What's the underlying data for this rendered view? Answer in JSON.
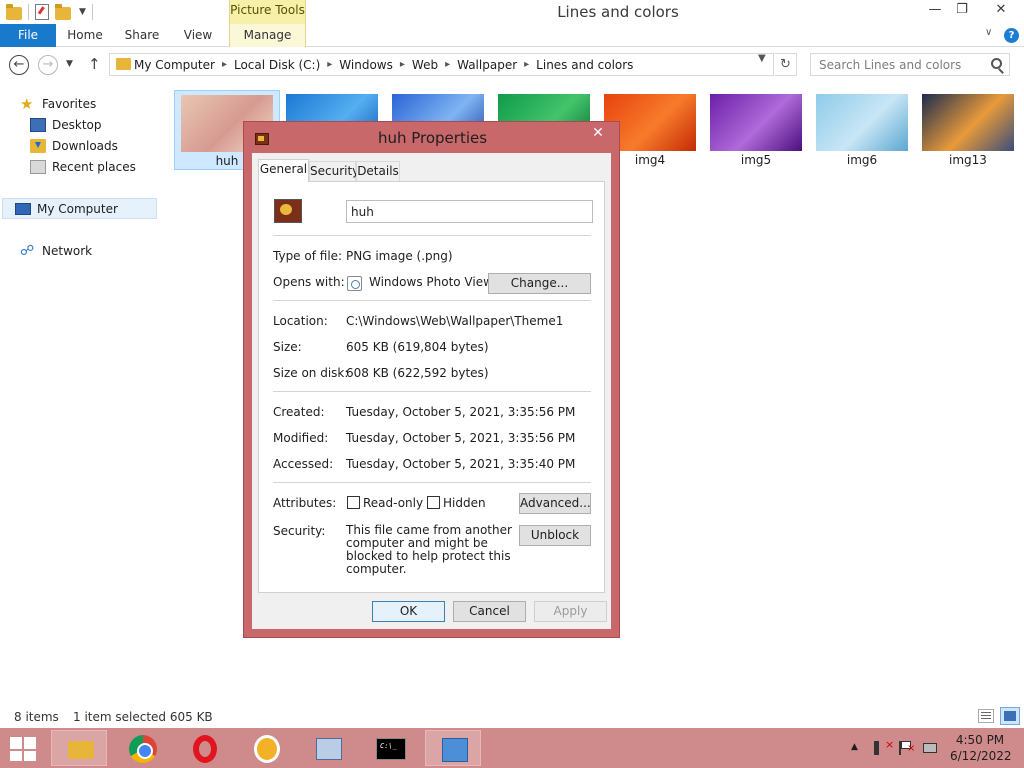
{
  "window": {
    "title": "Lines and colors",
    "context_tab": "Picture Tools",
    "controls": {
      "minimize": "—",
      "maximize": "❐",
      "close": "✕"
    }
  },
  "ribbon": {
    "file": "File",
    "tabs": [
      "Home",
      "Share",
      "View",
      "Manage"
    ]
  },
  "address": {
    "breadcrumbs": [
      "My Computer",
      "Local Disk (C:)",
      "Windows",
      "Web",
      "Wallpaper",
      "Lines and colors"
    ],
    "search_placeholder": "Search Lines and colors"
  },
  "navpane": {
    "favorites": "Favorites",
    "desktop": "Desktop",
    "downloads": "Downloads",
    "recent": "Recent places",
    "my_computer": "My Computer",
    "network": "Network"
  },
  "thumbnails": [
    {
      "label": "huh",
      "selected": true,
      "colors": [
        "#e8c7b1",
        "#d79a91",
        "#f1ddc9"
      ]
    },
    {
      "label": "",
      "selected": false,
      "colors": [
        "#1b78d4",
        "#55aef0",
        "#0f59b5"
      ]
    },
    {
      "label": "",
      "selected": false,
      "colors": [
        "#2a64d6",
        "#7fb4f3",
        "#1a3fa0"
      ]
    },
    {
      "label": "",
      "selected": false,
      "colors": [
        "#0f9a4a",
        "#43c46b",
        "#076a31"
      ]
    },
    {
      "label": "img4",
      "selected": false,
      "colors": [
        "#e8420f",
        "#f77b2a",
        "#c42a06"
      ]
    },
    {
      "label": "img5",
      "selected": false,
      "colors": [
        "#6b1fa8",
        "#b06ad9",
        "#4b0f7e"
      ]
    },
    {
      "label": "img6",
      "selected": false,
      "colors": [
        "#8fcbea",
        "#c8e6f5",
        "#5ca6d1"
      ]
    },
    {
      "label": "img13",
      "selected": false,
      "colors": [
        "#1c2c4e",
        "#e89a3a",
        "#3a4d7a"
      ]
    }
  ],
  "status": {
    "items": "8 items",
    "selected": "1 item selected  605 KB"
  },
  "dialog": {
    "title": "huh Properties",
    "close": "✕",
    "tabs": [
      "General",
      "Security",
      "Details"
    ],
    "filename": "huh",
    "type_label": "Type of file:",
    "type_value": "PNG image (.png)",
    "opens_label": "Opens with:",
    "opens_value": "Windows Photo Viewer",
    "change_button": "Change...",
    "location_label": "Location:",
    "location_value": "C:\\Windows\\Web\\Wallpaper\\Theme1",
    "size_label": "Size:",
    "size_value": "605 KB (619,804 bytes)",
    "disk_label": "Size on disk:",
    "disk_value": "608 KB (622,592 bytes)",
    "created_label": "Created:",
    "created_value": "Tuesday, October 5, 2021, 3:35:56 PM",
    "modified_label": "Modified:",
    "modified_value": "Tuesday, October 5, 2021, 3:35:56 PM",
    "accessed_label": "Accessed:",
    "accessed_value": "Tuesday, October 5, 2021, 3:35:40 PM",
    "attributes_label": "Attributes:",
    "readonly_label": "Read-only",
    "hidden_label": "Hidden",
    "advanced_button": "Advanced...",
    "security_label": "Security:",
    "security_text": "This file came from another computer and might be blocked to help protect this computer.",
    "unblock_button": "Unblock",
    "ok": "OK",
    "cancel": "Cancel",
    "apply": "Apply"
  },
  "taskbar": {
    "time": "4:50 PM",
    "date": "6/12/2022"
  }
}
